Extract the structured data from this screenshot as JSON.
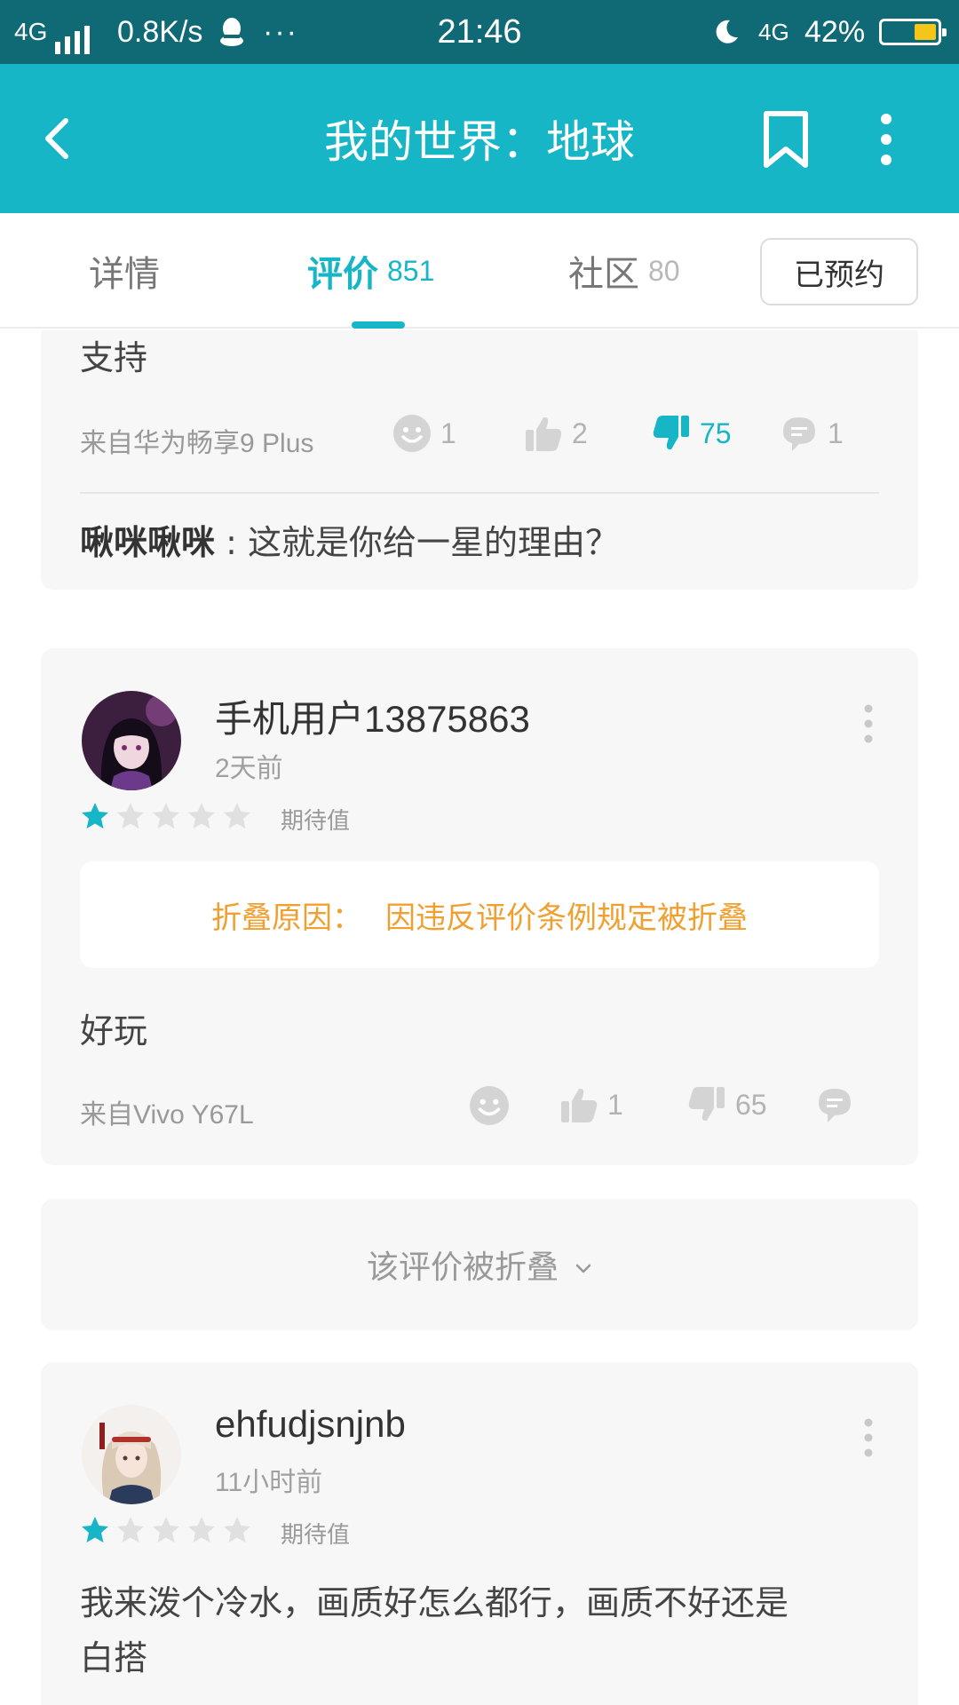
{
  "status_bar": {
    "network": "4G",
    "speed": "0.8K/s",
    "more": "···",
    "time": "21:46",
    "network2": "4G",
    "battery": "42%",
    "battery_level": 0.42,
    "icons": [
      "signal-icon",
      "qq-icon",
      "moon-icon",
      "battery-icon"
    ]
  },
  "header": {
    "title": "我的世界：地球",
    "icons": [
      "back-arrow-icon",
      "bookmark-icon",
      "more-vertical-icon"
    ],
    "color": "#17b6c6"
  },
  "tabs": {
    "detail": "详情",
    "review": "评价",
    "review_count": "851",
    "community": "社区",
    "community_count": "80",
    "reserve_button": "已预约",
    "active": "review"
  },
  "reviews": {
    "first": {
      "text": "支持",
      "device": "来自华为畅享9 Plus",
      "funny": "1",
      "likes": "2",
      "dislikes": "75",
      "comments": "1",
      "reply_user": "啾咪啾咪",
      "reply_sep": " : ",
      "reply_text": "这就是你给一星的理由？"
    },
    "second": {
      "username": "手机用户13875863",
      "time": "2天前",
      "rating": 1,
      "rating_label": "期待值",
      "fold_label": "折叠原因：",
      "fold_reason": "因违反评价条例规定被折叠",
      "text": "好玩",
      "device": "来自Vivo Y67L",
      "likes": "1",
      "dislikes": "65"
    },
    "folded": {
      "label": "该评价被折叠"
    },
    "third": {
      "username": "ehfudjsnjnb",
      "time": "11小时前",
      "rating": 1,
      "rating_label": "期待值",
      "text_line1": "我来泼个冷水，画质好怎么都行，画质不好还是",
      "text_line2": "白搭"
    }
  },
  "colors": {
    "accent": "#17b6c6",
    "status_bar": "#106a76",
    "fold_reason": "#f0a030"
  }
}
